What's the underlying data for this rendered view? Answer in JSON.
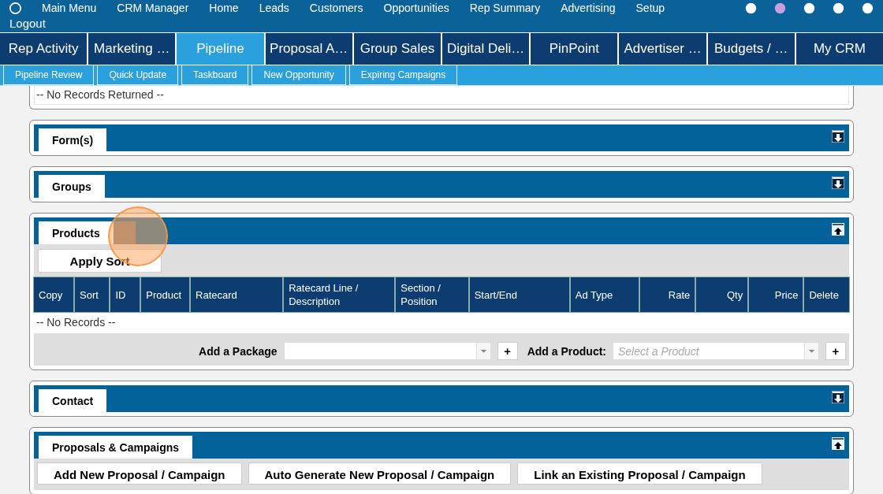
{
  "top_menu": {
    "items": [
      "Main Menu",
      "CRM Manager",
      "Home",
      "Leads",
      "Customers",
      "Opportunities",
      "Rep Summary",
      "Advertising",
      "Setup"
    ],
    "logout": "Logout"
  },
  "main_tabs": [
    {
      "label": "Rep Activity",
      "selected": false
    },
    {
      "label": "Marketing …",
      "selected": false
    },
    {
      "label": "Pipeline",
      "selected": true
    },
    {
      "label": "Proposal A…",
      "selected": false
    },
    {
      "label": "Group Sales",
      "selected": false
    },
    {
      "label": "Digital Deli…",
      "selected": false
    },
    {
      "label": "PinPoint",
      "selected": false
    },
    {
      "label": "Advertiser …",
      "selected": false
    },
    {
      "label": "Budgets / …",
      "selected": false
    },
    {
      "label": "My CRM",
      "selected": false
    }
  ],
  "sub_tabs": [
    "Pipeline Review",
    "Quick Update",
    "Taskboard",
    "New Opportunity",
    "Expiring Campaigns"
  ],
  "records_panel": {
    "message": "-- No Records Returned --"
  },
  "panels": [
    {
      "title": "Form(s)",
      "expanded": false
    },
    {
      "title": "Groups",
      "expanded": false
    },
    {
      "title": "Products",
      "expanded": true,
      "kind": "products",
      "apply_sort": "Apply Sort",
      "columns": [
        "Copy",
        "Sort",
        "ID",
        "Product",
        "Ratecard",
        "Ratecard Line / Description",
        "Section / Position",
        "Start/End",
        "Ad Type",
        "Rate",
        "Qty",
        "Price",
        "Delete"
      ],
      "empty": "-- No Records --",
      "package_label": "Add a Package",
      "add": "+",
      "product_label": "Add a Product:",
      "product_placeholder": "Select a Product"
    },
    {
      "title": "Contact",
      "expanded": false
    },
    {
      "title": "Proposals & Campaigns",
      "expanded": true,
      "kind": "proposals",
      "buttons": [
        "Add New Proposal / Campaign",
        "Auto Generate New Proposal / Campaign",
        "Link an Existing Proposal / Campaign"
      ]
    }
  ]
}
